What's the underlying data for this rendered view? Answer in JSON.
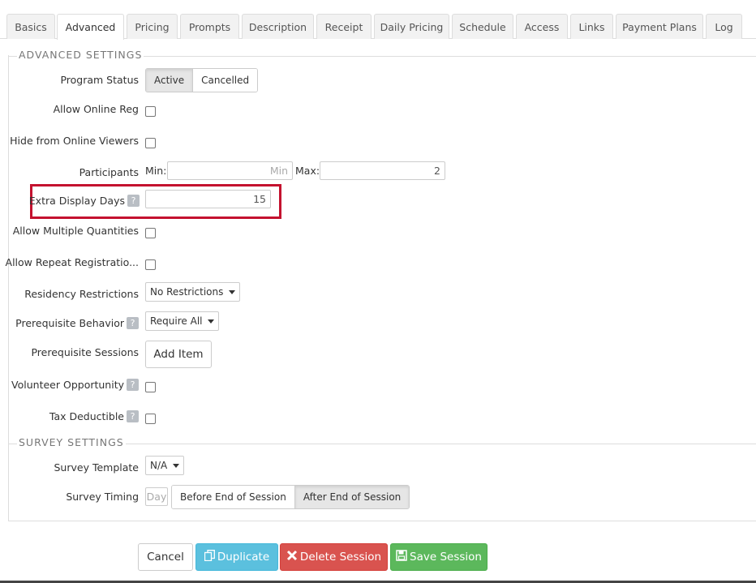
{
  "tabs": [
    {
      "label": "Basics",
      "active": false
    },
    {
      "label": "Advanced",
      "active": true
    },
    {
      "label": "Pricing",
      "active": false
    },
    {
      "label": "Prompts",
      "active": false
    },
    {
      "label": "Description",
      "active": false
    },
    {
      "label": "Receipt",
      "active": false
    },
    {
      "label": "Daily Pricing",
      "active": false
    },
    {
      "label": "Schedule",
      "active": false
    },
    {
      "label": "Access",
      "active": false
    },
    {
      "label": "Links",
      "active": false
    },
    {
      "label": "Payment Plans",
      "active": false
    },
    {
      "label": "Log",
      "active": false
    }
  ],
  "advanced": {
    "legend": "ADVANCED SETTINGS",
    "program_status": {
      "label": "Program Status",
      "options": [
        "Active",
        "Cancelled"
      ],
      "selected": "Active"
    },
    "allow_online_reg": {
      "label": "Allow Online Reg",
      "checked": false
    },
    "hide_online": {
      "label": "Hide from Online Viewers",
      "checked": false
    },
    "participants": {
      "label": "Participants",
      "min_label": "Min:",
      "min_placeholder": "Min",
      "max_label": "Max:",
      "max_value": "2"
    },
    "extra_display_days": {
      "label": "Extra Display Days",
      "help": "?",
      "value": "15"
    },
    "allow_multiple": {
      "label": "Allow Multiple Quantities",
      "checked": false
    },
    "allow_repeat": {
      "label": "Allow Repeat Registratio...",
      "checked": false
    },
    "residency": {
      "label": "Residency Restrictions",
      "selected": "No Restrictions"
    },
    "prereq_behavior": {
      "label": "Prerequisite Behavior",
      "help": "?",
      "selected": "Require All"
    },
    "prereq_sessions": {
      "label": "Prerequisite Sessions",
      "button": "Add Item"
    },
    "volunteer": {
      "label": "Volunteer Opportunity",
      "help": "?",
      "checked": false
    },
    "tax_deductible": {
      "label": "Tax Deductible",
      "help": "?",
      "checked": false
    }
  },
  "survey": {
    "legend": "SURVEY SETTINGS",
    "template": {
      "label": "Survey Template",
      "selected": "N/A"
    },
    "timing": {
      "label": "Survey Timing",
      "day_placeholder": "Day",
      "options": [
        "Before End of Session",
        "After End of Session"
      ],
      "selected": "After End of Session"
    }
  },
  "actions": {
    "cancel": "Cancel",
    "duplicate": "Duplicate",
    "delete": "Delete Session",
    "save": "Save Session"
  },
  "icons": {
    "duplicate": "copy-icon",
    "delete": "x-icon",
    "save": "floppy-disk-icon"
  },
  "colors": {
    "highlight": "#c4122f",
    "info": "#5bc0de",
    "danger": "#d9534f",
    "success": "#5cb85c"
  }
}
